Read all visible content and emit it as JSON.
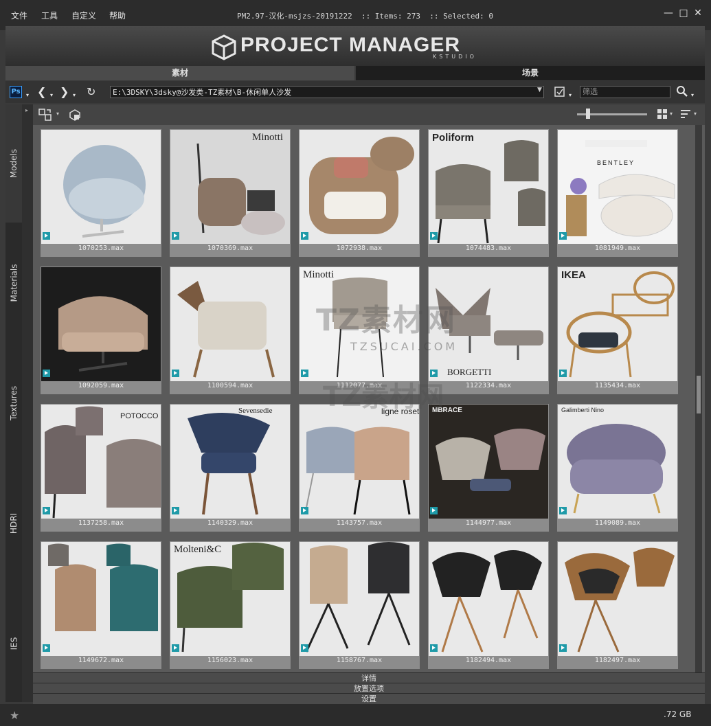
{
  "menu": [
    "文件",
    "工具",
    "自定义",
    "帮助"
  ],
  "window_title": "PM2.97-汉化-msjzs-20191222  :: Items: 273  :: Selected: 0",
  "window_controls": {
    "minimize": "—",
    "maximize": "□",
    "close": "✕"
  },
  "banner": {
    "title": "PROJECT MANAGER",
    "subtitle": "KSTUDIO"
  },
  "tabs": [
    {
      "label": "素材",
      "active": true
    },
    {
      "label": "场景",
      "active": false
    }
  ],
  "toolbar": {
    "ps_label": "Ps",
    "path": "E:\\3DSKY\\3dsky@沙发类-TZ素材\\B-休闲单人沙发",
    "filter_placeholder": "筛选"
  },
  "side_tabs": [
    "Models",
    "Materials",
    "Textures",
    "HDRI",
    "IES"
  ],
  "items": [
    {
      "file": "1070253.max",
      "brand": "",
      "dark": false
    },
    {
      "file": "1070369.max",
      "brand": "Minotti",
      "dark": false
    },
    {
      "file": "1072938.max",
      "brand": "",
      "dark": false
    },
    {
      "file": "1074483.max",
      "brand": "Poliform",
      "dark": false
    },
    {
      "file": "1081949.max",
      "brand": "BENTLEY",
      "dark": false
    },
    {
      "file": "1092059.max",
      "brand": "",
      "dark": true
    },
    {
      "file": "1100594.max",
      "brand": "",
      "dark": false
    },
    {
      "file": "1112077.max",
      "brand": "Minotti",
      "dark": false
    },
    {
      "file": "1122334.max",
      "brand": "BORGETTI",
      "dark": false
    },
    {
      "file": "1135434.max",
      "brand": "IKEA",
      "dark": false
    },
    {
      "file": "1137258.max",
      "brand": "POTOCCO",
      "dark": false
    },
    {
      "file": "1140329.max",
      "brand": "Sevensedie",
      "dark": false
    },
    {
      "file": "1143757.max",
      "brand": "ligne roset",
      "dark": false
    },
    {
      "file": "1144977.max",
      "brand": "MBRACE",
      "dark": true
    },
    {
      "file": "1149089.max",
      "brand": "Galimberti Nino",
      "dark": false
    },
    {
      "file": "1149672.max",
      "brand": "",
      "dark": false
    },
    {
      "file": "1156023.max",
      "brand": "Molteni&C",
      "dark": false
    },
    {
      "file": "1158767.max",
      "brand": "",
      "dark": false
    },
    {
      "file": "1182494.max",
      "brand": "",
      "dark": false
    },
    {
      "file": "1182497.max",
      "brand": "",
      "dark": false
    }
  ],
  "panels": [
    "详情",
    "放置选项",
    "设置"
  ],
  "status": {
    "disk": ".72 GB"
  },
  "watermark": {
    "line1": "TZ素材网",
    "line2": "TZSUCAI.COM",
    "line3": "TZ素材网"
  },
  "colors": {
    "accent": "#1f9aa8",
    "background": "#3a3a3a"
  }
}
